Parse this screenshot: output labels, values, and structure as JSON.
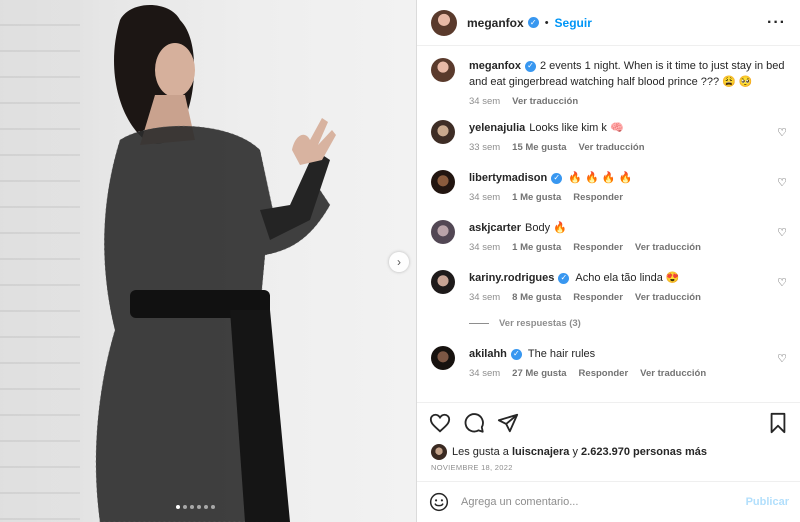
{
  "post": {
    "photo_alt": "",
    "carousel_dots": 6,
    "active_dot": 0
  },
  "header": {
    "username": "meganfox",
    "verified": true,
    "follow_label": "Seguir",
    "separator": "•",
    "more_icon": "more-horizontal-icon"
  },
  "caption": {
    "username": "meganfox",
    "text": "2 events 1 night. When is it time to just stay in bed and eat gingerbread watching half blood prince ??? 😩 🥺",
    "time": "34 sem",
    "translate": "Ver traducción"
  },
  "comments": [
    {
      "username": "yelenajulia",
      "verified": false,
      "text": "Looks like kim k 🧠",
      "time": "33 sem",
      "likes": "15 Me gusta",
      "reply": "",
      "translate": "Ver traducción"
    },
    {
      "username": "libertymadison",
      "verified": true,
      "text": "🔥 🔥 🔥 🔥",
      "time": "34 sem",
      "likes": "1 Me gusta",
      "reply": "Responder",
      "translate": ""
    },
    {
      "username": "askjcarter",
      "verified": false,
      "text": "Body 🔥",
      "time": "34 sem",
      "likes": "1 Me gusta",
      "reply": "Responder",
      "translate": "Ver traducción"
    },
    {
      "username": "kariny.rodrigues",
      "verified": true,
      "text": "Acho ela tão linda 😍",
      "time": "34 sem",
      "likes": "8 Me gusta",
      "reply": "Responder",
      "translate": "Ver traducción"
    },
    {
      "username": "akilahh",
      "verified": true,
      "text": "The hair rules",
      "time": "34 sem",
      "likes": "27 Me gusta",
      "reply": "Responder",
      "translate": "Ver traducción"
    }
  ],
  "view_replies": "Ver respuestas (3)",
  "likes_line": {
    "prefix": "Les gusta a",
    "user": "luiscnajera",
    "joiner": "y",
    "count": "2.623.970 personas más"
  },
  "date": "NOVIEMBRE 18, 2022",
  "composer": {
    "placeholder": "Agrega un comentario...",
    "post_label": "Publicar"
  },
  "colors": {
    "accent": "#0095f6",
    "verified": "#3897f0",
    "muted": "#8e8e8e",
    "post_disabled": "#b2dffc"
  }
}
